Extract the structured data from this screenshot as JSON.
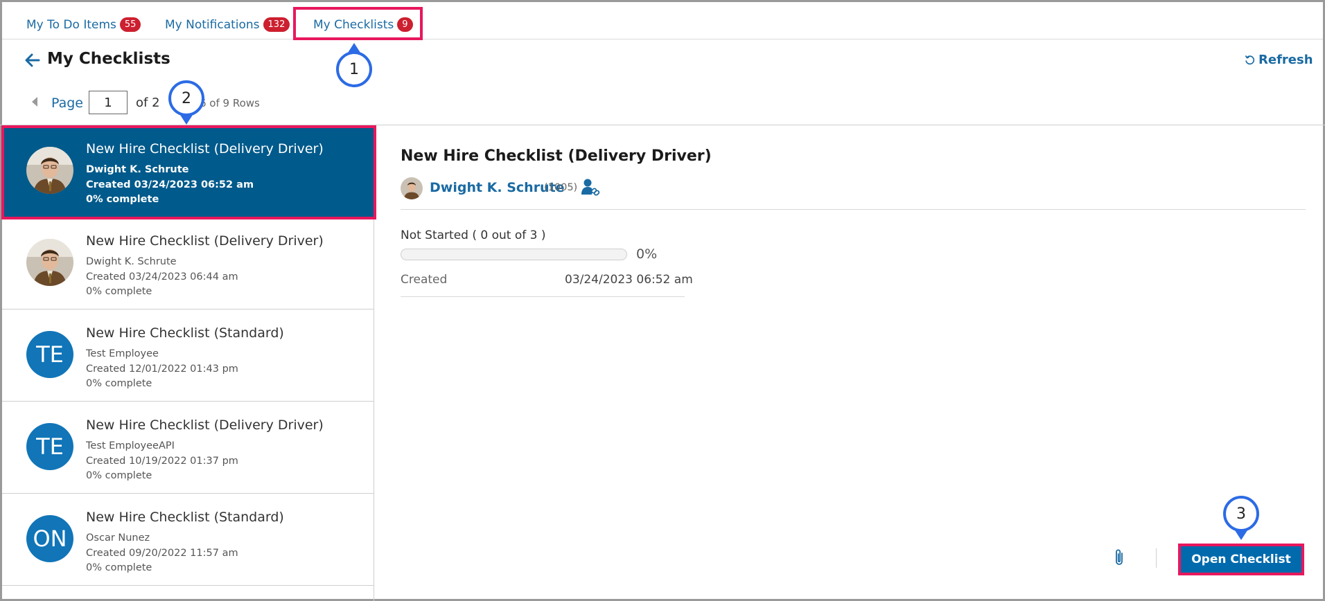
{
  "tabs": [
    {
      "label": "My To Do Items",
      "badge": "55"
    },
    {
      "label": "My Notifications",
      "badge": "132"
    },
    {
      "label": "My Checklists",
      "badge": "9"
    }
  ],
  "header": {
    "title": "My Checklists",
    "refresh_label": "Refresh"
  },
  "pager": {
    "page_label": "Page",
    "page_value": "1",
    "of_label": "of 2",
    "rows_label": "6 of 9 Rows"
  },
  "callouts": [
    "1",
    "2",
    "3"
  ],
  "list": [
    {
      "title": "New Hire Checklist (Delivery Driver)",
      "person": "Dwight K. Schrute",
      "created": "Created 03/24/2023 06:52 am",
      "progress": "0% complete",
      "avatar": "photo",
      "selected": true
    },
    {
      "title": "New Hire Checklist (Delivery Driver)",
      "person": "Dwight K. Schrute",
      "created": "Created 03/24/2023 06:44 am",
      "progress": "0% complete",
      "avatar": "photo",
      "selected": false
    },
    {
      "title": "New Hire Checklist (Standard)",
      "person": "Test Employee",
      "created": "Created 12/01/2022 01:43 pm",
      "progress": "0% complete",
      "avatar": "TE",
      "selected": false
    },
    {
      "title": "New Hire Checklist (Delivery Driver)",
      "person": "Test EmployeeAPI",
      "created": "Created 10/19/2022 01:37 pm",
      "progress": "0% complete",
      "avatar": "TE",
      "selected": false
    },
    {
      "title": "New Hire Checklist (Standard)",
      "person": "Oscar Nunez",
      "created": "Created 09/20/2022 11:57 am",
      "progress": "0% complete",
      "avatar": "ON",
      "selected": false
    }
  ],
  "detail": {
    "title": "New Hire Checklist (Delivery Driver)",
    "person": "Dwight K. Schrute",
    "person_id": "(1005)",
    "status": "Not Started ( 0 out of 3 )",
    "progress_percent": 0,
    "progress_label": "0%",
    "created_label": "Created",
    "created_value": "03/24/2023 06:52 am",
    "open_button": "Open Checklist"
  },
  "colors": {
    "accent": "#1a6aa3",
    "selected_bg": "#005a8b",
    "badge": "#cc1f2f",
    "highlight": "#e8175d",
    "callout": "#2c6be5",
    "button": "#006aad"
  }
}
